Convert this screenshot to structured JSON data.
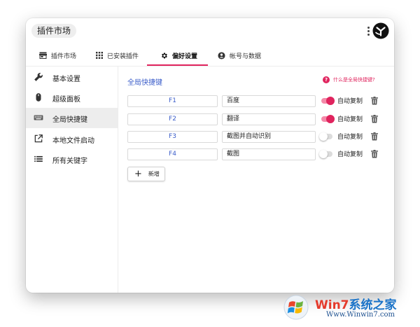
{
  "app": {
    "title": "插件市场"
  },
  "tabs": [
    {
      "label": "插件市场",
      "icon": "store-icon"
    },
    {
      "label": "已安装插件",
      "icon": "grid-icon"
    },
    {
      "label": "偏好设置",
      "icon": "gear-icon",
      "active": true
    },
    {
      "label": "帐号与数据",
      "icon": "account-icon"
    }
  ],
  "sidebar": {
    "items": [
      {
        "label": "基本设置",
        "icon": "wrench-icon"
      },
      {
        "label": "超级面板",
        "icon": "mouse-icon"
      },
      {
        "label": "全局快捷键",
        "icon": "keyboard-icon",
        "active": true
      },
      {
        "label": "本地文件启动",
        "icon": "open-external-icon"
      },
      {
        "label": "所有关键字",
        "icon": "list-icon"
      }
    ]
  },
  "main": {
    "section_title": "全局快捷键",
    "help_text": "什么是全局快捷键?",
    "help_icon": "?",
    "toggle_label": "自动复制",
    "shortcuts": [
      {
        "key": "F1",
        "value": "百度",
        "auto_copy": true
      },
      {
        "key": "F2",
        "value": "翻译",
        "auto_copy": true
      },
      {
        "key": "F3",
        "value": "截图并自动识别",
        "auto_copy": false
      },
      {
        "key": "F4",
        "value": "截图",
        "auto_copy": false
      }
    ],
    "add_button": {
      "icon": "+",
      "label": "新增"
    }
  },
  "watermark": {
    "brand_prefix": "Win7",
    "brand_suffix": "系统之家",
    "url": "Www.Winwin7.com"
  },
  "colors": {
    "accent": "#e0245e",
    "link_blue": "#3a5cc9",
    "active_bg": "#ededed"
  }
}
